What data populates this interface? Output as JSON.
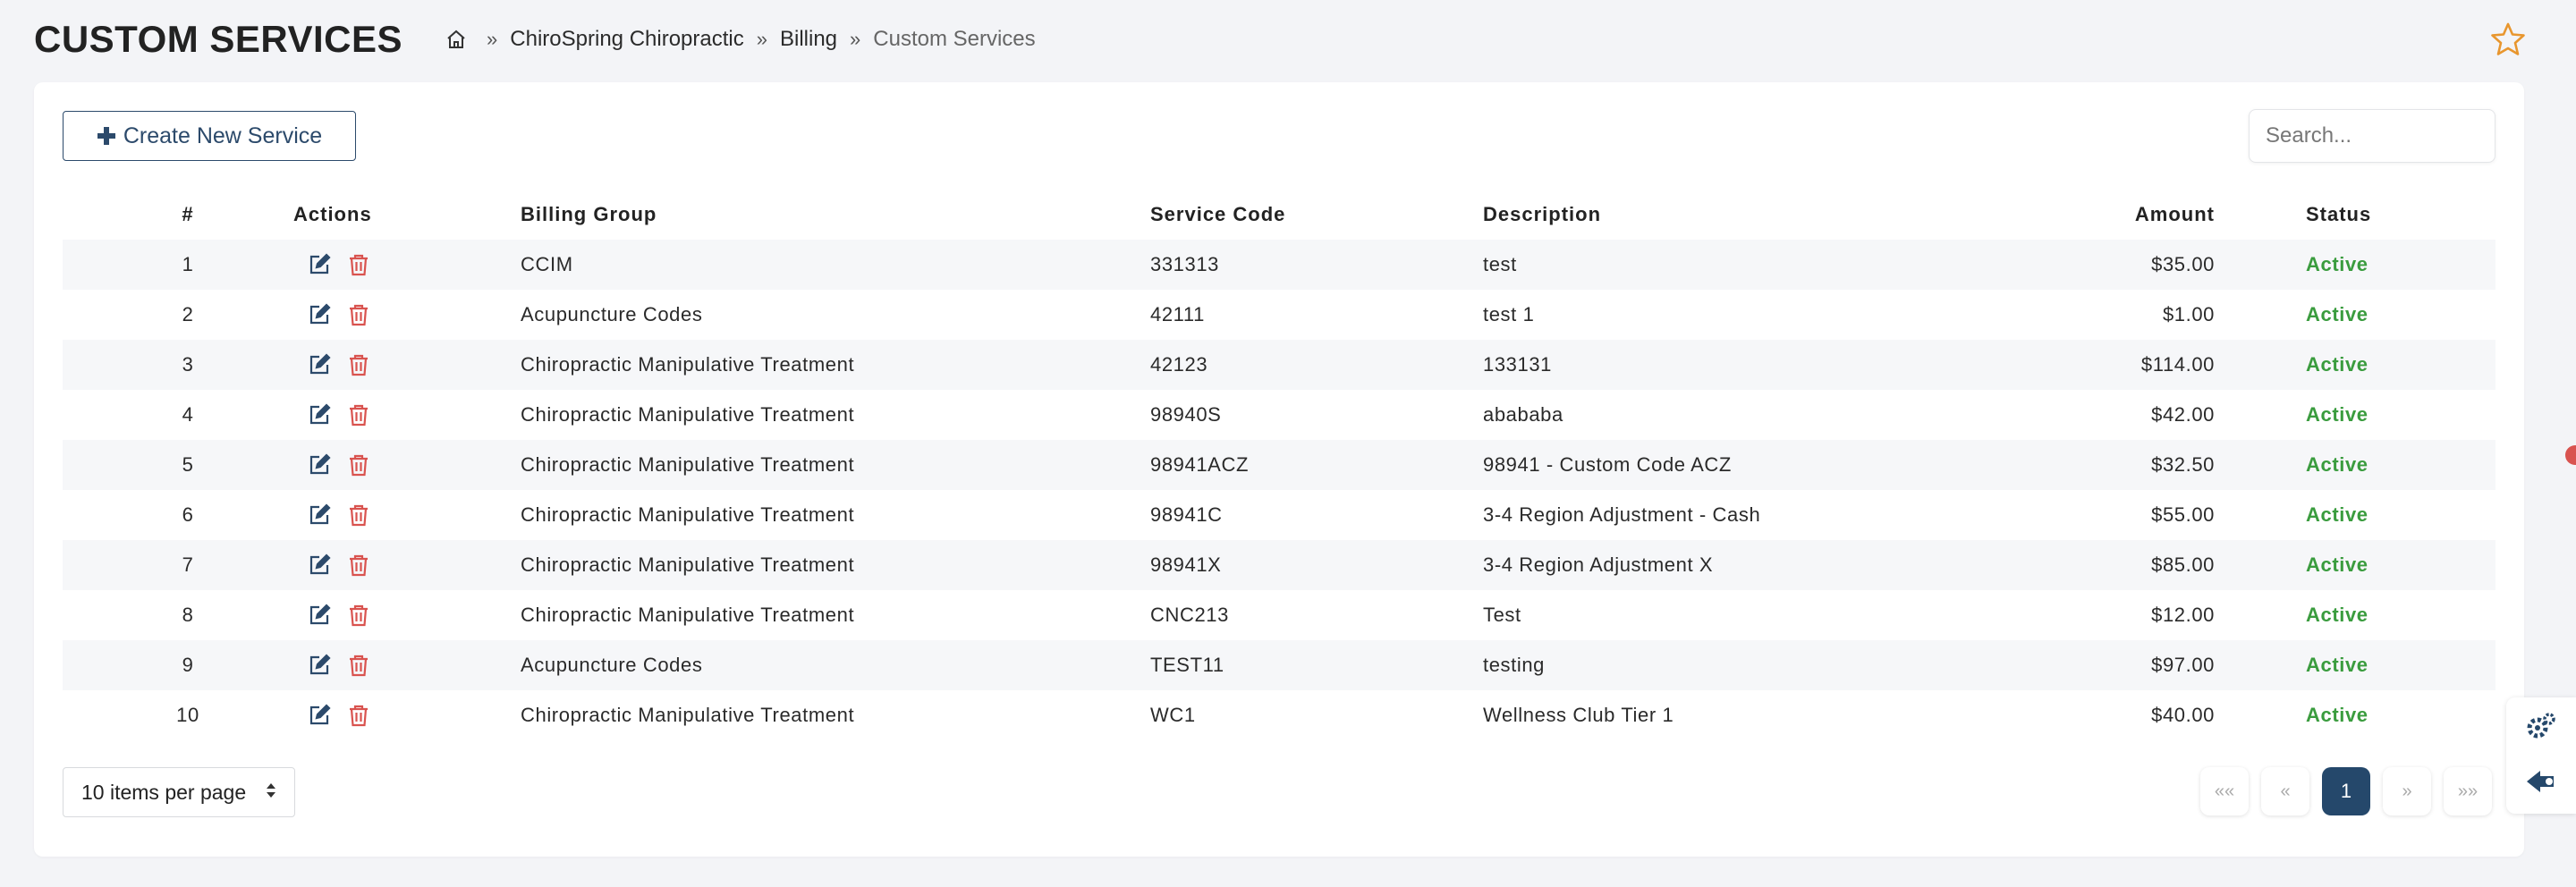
{
  "header": {
    "title": "CUSTOM SERVICES",
    "breadcrumb": {
      "home_icon": "home-icon",
      "separator": "»",
      "items": [
        "ChiroSpring Chiropractic",
        "Billing",
        "Custom Services"
      ]
    },
    "favorite_icon": "star-icon"
  },
  "toolbar": {
    "create_label": "Create New Service",
    "search_placeholder": "Search..."
  },
  "table": {
    "headers": {
      "num": "#",
      "actions": "Actions",
      "group": "Billing Group",
      "code": "Service Code",
      "desc": "Description",
      "amount": "Amount",
      "status": "Status"
    },
    "rows": [
      {
        "num": "1",
        "group": "CCIM",
        "code": "331313",
        "desc": "test",
        "amount": "$35.00",
        "status": "Active"
      },
      {
        "num": "2",
        "group": "Acupuncture Codes",
        "code": "42111",
        "desc": "test 1",
        "amount": "$1.00",
        "status": "Active"
      },
      {
        "num": "3",
        "group": "Chiropractic Manipulative Treatment",
        "code": "42123",
        "desc": "133131",
        "amount": "$114.00",
        "status": "Active"
      },
      {
        "num": "4",
        "group": "Chiropractic Manipulative Treatment",
        "code": "98940S",
        "desc": "abababa",
        "amount": "$42.00",
        "status": "Active"
      },
      {
        "num": "5",
        "group": "Chiropractic Manipulative Treatment",
        "code": "98941ACZ",
        "desc": "98941 - Custom Code ACZ",
        "amount": "$32.50",
        "status": "Active"
      },
      {
        "num": "6",
        "group": "Chiropractic Manipulative Treatment",
        "code": "98941C",
        "desc": "3-4 Region Adjustment - Cash",
        "amount": "$55.00",
        "status": "Active"
      },
      {
        "num": "7",
        "group": "Chiropractic Manipulative Treatment",
        "code": "98941X",
        "desc": "3-4 Region Adjustment X",
        "amount": "$85.00",
        "status": "Active"
      },
      {
        "num": "8",
        "group": "Chiropractic Manipulative Treatment",
        "code": "CNC213",
        "desc": "Test",
        "amount": "$12.00",
        "status": "Active"
      },
      {
        "num": "9",
        "group": "Acupuncture Codes",
        "code": "TEST11",
        "desc": "testing",
        "amount": "$97.00",
        "status": "Active"
      },
      {
        "num": "10",
        "group": "Chiropractic Manipulative Treatment",
        "code": "WC1",
        "desc": "Wellness Club Tier 1",
        "amount": "$40.00",
        "status": "Active"
      }
    ]
  },
  "footer": {
    "per_page_label": "10 items per page",
    "pagination": {
      "first": "««",
      "prev": "«",
      "current": "1",
      "next": "»",
      "last": "»»"
    }
  },
  "colors": {
    "accent": "#25486b",
    "status_active": "#3a9c3e",
    "delete_icon": "#d9534f",
    "edit_icon": "#2c4a6b",
    "star": "#e8962e"
  }
}
